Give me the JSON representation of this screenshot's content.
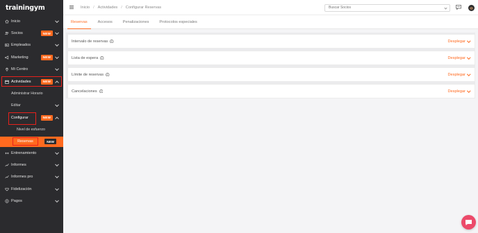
{
  "brand": {
    "logo_text": "trainingym"
  },
  "sidebar": {
    "items": [
      {
        "label": "Inicio",
        "icon": "home-icon"
      },
      {
        "label": "Socios",
        "icon": "users-icon",
        "badge": "NEW"
      },
      {
        "label": "Empleados",
        "icon": "id-card-icon"
      },
      {
        "label": "Marketing",
        "icon": "megaphone-icon",
        "badge": "NEW"
      },
      {
        "label": "Mi Centro",
        "icon": "location-icon"
      },
      {
        "label": "Actividades",
        "icon": "calendar-icon",
        "badge": "NEW",
        "expanded": true,
        "children": [
          {
            "label": "Administrar Horario"
          },
          {
            "label": "Editar"
          },
          {
            "label": "Configurar",
            "badge": "NEW",
            "expanded": true,
            "children": [
              {
                "label": "Nivel de esfuerzo"
              },
              {
                "label": "Reservas",
                "badge": "NEW",
                "active": true
              }
            ]
          }
        ]
      },
      {
        "label": "Entrenamiento",
        "icon": "dumbbell-icon"
      },
      {
        "label": "Informes",
        "icon": "chart-icon"
      },
      {
        "label": "Informes pro",
        "icon": "chart-pro-icon"
      },
      {
        "label": "Fidelización",
        "icon": "heart-icon"
      },
      {
        "label": "Pagos",
        "icon": "payments-icon"
      }
    ]
  },
  "header": {
    "breadcrumb": [
      "Inicio",
      "Actividades",
      "Configurar Reservas"
    ],
    "search_placeholder": "Buscar Socios"
  },
  "tabs": [
    {
      "label": "Reservas",
      "active": true
    },
    {
      "label": "Accesos"
    },
    {
      "label": "Penalizaciones"
    },
    {
      "label": "Protocolos especiales"
    }
  ],
  "sections": [
    {
      "label": "Intervalo de reservas",
      "toggle": "Desplegar"
    },
    {
      "label": "Lista de espera",
      "toggle": "Desplegar"
    },
    {
      "label": "Límite de reservas",
      "toggle": "Desplegar"
    },
    {
      "label": "Cancelaciones",
      "toggle": "Desplegar"
    }
  ],
  "colors": {
    "accent": "#ff6a1f",
    "sidebar_bg": "#2b2b2e",
    "highlight": "#e8211c",
    "chat": "#ec4a6a"
  }
}
